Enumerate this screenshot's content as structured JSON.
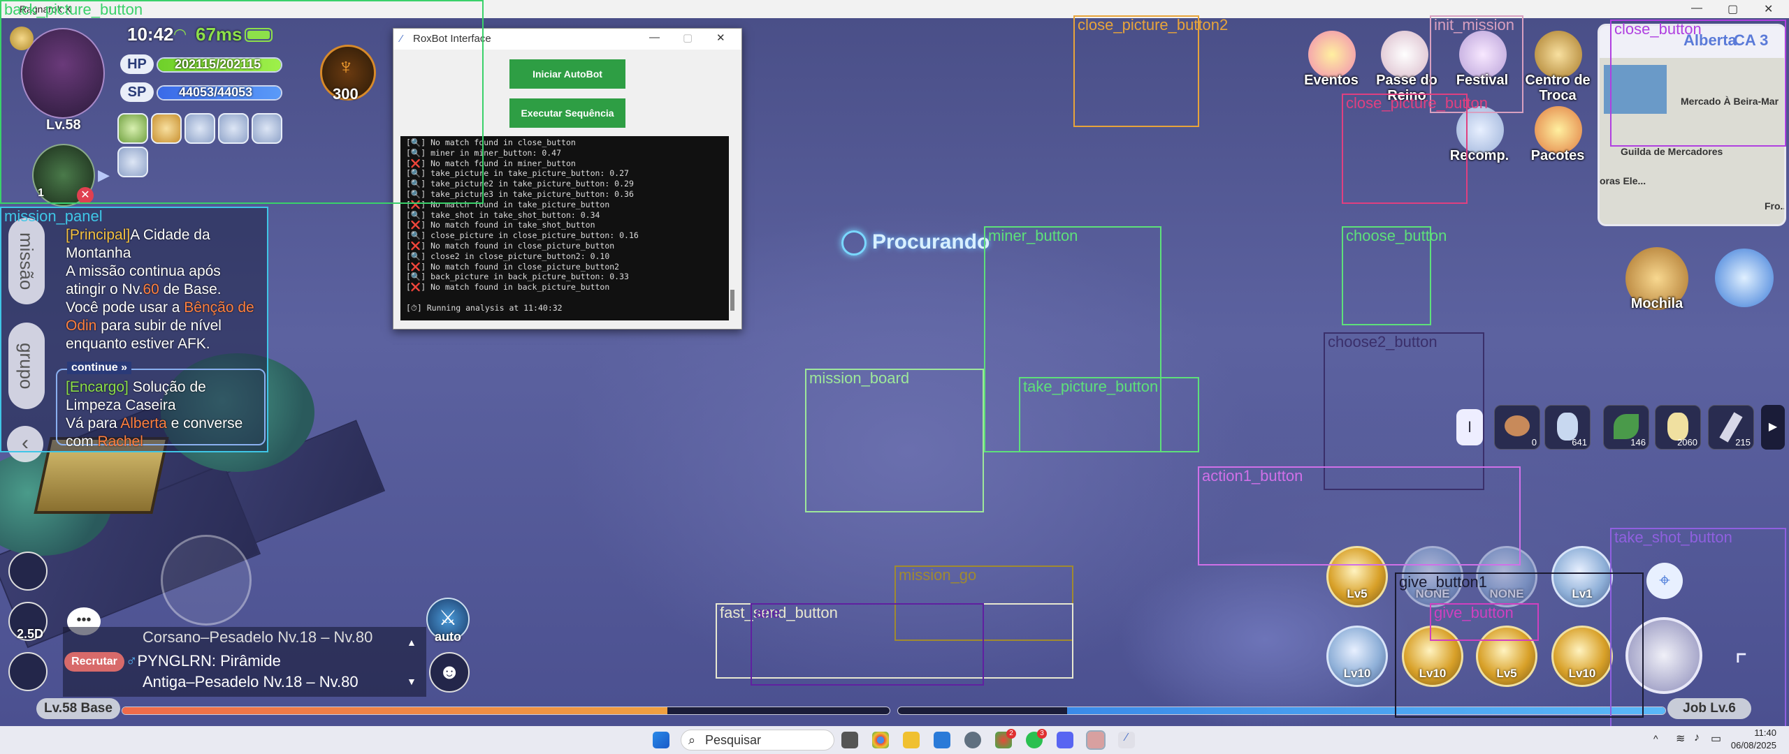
{
  "window": {
    "title": "Ragnarok X"
  },
  "hud": {
    "time": "10:42",
    "ping": "67ms",
    "level": "Lv.58",
    "hp_label": "HP",
    "hp_value": "202115/202115",
    "sp_label": "SP",
    "sp_value": "44053/44053",
    "sp_ratio": 1.0,
    "hp_ratio": 1.0,
    "points": "300",
    "pet_level": "1",
    "auto_label": "auto",
    "zoom": "2.5D",
    "searching": "Procurando"
  },
  "quest": {
    "tab_mission": "missão",
    "tab_group": "grupo",
    "main_tag": "[Principal]",
    "main_title_1": "A Cidade da",
    "main_title_2": "Montanha",
    "main_l1": "A missão continua após",
    "main_l2_pre": "atingir o Nv.",
    "main_l2_num": "60",
    "main_l2_post": " de Base.",
    "main_l3_pre": "Você pode usar a ",
    "main_l3_hl": "Bênção de",
    "main_l4_hl": "Odin",
    "main_l4_post": " para subir de nível",
    "main_l5": "enquanto estiver AFK.",
    "continue": "continue",
    "side_tag": "[Encargo]",
    "side_title_1": " Solução de",
    "side_title_2": "Limpeza Caseira",
    "side_l1_pre": "Vá para ",
    "side_l1_hl": "Alberta",
    "side_l1_post": " e converse",
    "side_l2_pre": "com ",
    "side_l2_hl": "Rachel"
  },
  "chat": {
    "line1": "Corsano–Pesadelo Nv.18 – Nv.80",
    "recruit": "Recrutar",
    "line2": "PYNGLRN: Pirâmide",
    "line3": "Antiga–Pesadelo Nv.18 – Nv.80"
  },
  "top_menu": [
    {
      "label": "Eventos"
    },
    {
      "label": "Passe do Reino"
    },
    {
      "label": "Festival"
    },
    {
      "label": "Centro de Troca"
    },
    {
      "label": "Recomp."
    },
    {
      "label": "Pacotes"
    }
  ],
  "minimap": {
    "area": "Alberta",
    "channel": "CA 3",
    "place1": "Mercado À Beira-Mar",
    "place2": "Guilda de Mercadores",
    "place3": "oras Ele...",
    "place4": "Fro..."
  },
  "right_hud": {
    "bag": "Mochila"
  },
  "items": [
    {
      "count": "0"
    },
    {
      "count": "641"
    },
    {
      "count": "146"
    },
    {
      "count": "2060"
    },
    {
      "count": "215"
    }
  ],
  "skills_top": [
    {
      "lv": "Lv5"
    },
    {
      "lv": "NONE"
    },
    {
      "lv": "NONE"
    },
    {
      "lv": "Lv1"
    }
  ],
  "skills_bottom": [
    {
      "lv": "Lv10"
    },
    {
      "lv": "Lv10"
    },
    {
      "lv": "Lv5"
    },
    {
      "lv": "Lv10"
    }
  ],
  "exp": {
    "base": "Lv.58 Base",
    "job": "Job  Lv.6",
    "base_ratio": 0.71,
    "job_ratio": 0.78
  },
  "roxbot": {
    "title": "RoxBot Interface",
    "btn_start": "Iniciar AutoBot",
    "btn_seq": "Executar Sequência",
    "log": [
      "[🔍] No match found in close_button",
      "[🔍] miner in miner_button: 0.47",
      "[❌] No match found in miner_button",
      "[🔍] take_picture in take_picture_button: 0.27",
      "[🔍] take_picture2 in take_picture_button: 0.29",
      "[🔍] take_picture3 in take_picture_button: 0.36",
      "[❌] No match found in take_picture_button",
      "[🔍] take_shot in take_shot_button: 0.34",
      "[❌] No match found in take_shot_button",
      "[🔍] close_picture in close_picture_button: 0.16",
      "[❌] No match found in close_picture_button",
      "[🔍] close2 in close_picture_button2: 0.10",
      "[❌] No match found in close_picture_button2",
      "[🔍] back_picture in back_picture_button: 0.33",
      "[❌] No match found in back_picture_button",
      "",
      "[⏱] Running analysis at 11:40:32"
    ]
  },
  "detections": [
    {
      "label": "back_picture_button",
      "color": "#3ad16a"
    },
    {
      "label": "mission_panel",
      "color": "#3fc6e6"
    },
    {
      "label": "close_picture_button2",
      "color": "#e8a43a"
    },
    {
      "label": "init_mission",
      "color": "#d8a0c0"
    },
    {
      "label": "close_button",
      "color": "#b040e0"
    },
    {
      "label": "close_picture_button",
      "color": "#e04080"
    },
    {
      "label": "miner_button",
      "color": "#5ee07a"
    },
    {
      "label": "choose_button",
      "color": "#5ee07a"
    },
    {
      "label": "choose2_button",
      "color": "#3a2f6a"
    },
    {
      "label": "mission_board",
      "color": "#9ee89a"
    },
    {
      "label": "take_picture_button",
      "color": "#5ee07a"
    },
    {
      "label": "action1_button",
      "color": "#d070e8"
    },
    {
      "label": "take_shot_button",
      "color": "#9060e0"
    },
    {
      "label": "mission_go",
      "color": "#a08a30"
    },
    {
      "label": "give_button1",
      "color": "#1a1a30"
    },
    {
      "label": "give_button",
      "color": "#d040c0"
    },
    {
      "label": "fast_send_button",
      "color": "#e8e8d0"
    },
    {
      "label": "ane",
      "color": "#6020a0"
    }
  ],
  "taskbar": {
    "search": "Pesquisar",
    "time": "11:40",
    "date": "06/08/2025",
    "badge1": "2",
    "badge2": "3"
  }
}
